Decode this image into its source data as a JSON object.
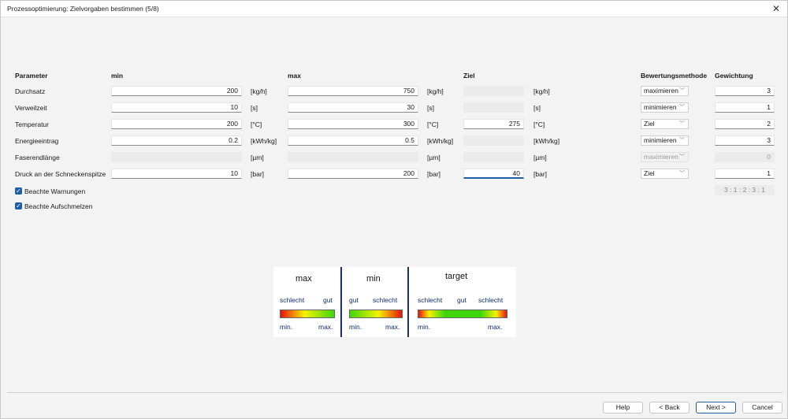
{
  "window": {
    "title": "Prozessoptimierung: Zielvorgaben bestimmen (5/8)",
    "close_glyph": "✕"
  },
  "headers": {
    "parameter": "Parameter",
    "min": "min",
    "max": "max",
    "ziel": "Ziel",
    "methode": "Bewertungsmethode",
    "gewichtung": "Gewichtung"
  },
  "rows": [
    {
      "label": "Durchsatz",
      "min": "200",
      "min_unit": "[kg/h]",
      "max": "750",
      "max_unit": "[kg/h]",
      "ziel": "",
      "ziel_unit": "[kg/h]",
      "methode": "maximieren",
      "gewichtung": "3"
    },
    {
      "label": "Verweilzeit",
      "min": "10",
      "min_unit": "[s]",
      "max": "30",
      "max_unit": "[s]",
      "ziel": "",
      "ziel_unit": "[s]",
      "methode": "minimieren",
      "gewichtung": "1"
    },
    {
      "label": "Temperatur",
      "min": "200",
      "min_unit": "[°C]",
      "max": "300",
      "max_unit": "[°C]",
      "ziel": "275",
      "ziel_unit": "[°C]",
      "methode": "Ziel",
      "gewichtung": "2"
    },
    {
      "label": "Energieeintrag",
      "min": "0.2",
      "min_unit": "[kWh/kg]",
      "max": "0.5",
      "max_unit": "[kWh/kg]",
      "ziel": "",
      "ziel_unit": "[kWh/kg]",
      "methode": "minimieren",
      "gewichtung": "3"
    },
    {
      "label": "Faserendlänge",
      "min": "",
      "min_unit": "[µm]",
      "max": "",
      "max_unit": "[µm]",
      "ziel": "",
      "ziel_unit": "[µm]",
      "methode": "maximieren",
      "gewichtung": "0"
    },
    {
      "label": "Druck an der Schneckenspitze",
      "min": "10",
      "min_unit": "[bar]",
      "max": "200",
      "max_unit": "[bar]",
      "ziel": "40",
      "ziel_unit": "[bar]",
      "methode": "Ziel",
      "gewichtung": "1"
    }
  ],
  "checkboxes": [
    {
      "label": "Beachte Warnungen",
      "checked": true
    },
    {
      "label": "Beachte Aufschmelzen",
      "checked": true
    }
  ],
  "ratio": "3 : 1 : 2 : 3 : 1",
  "legend": {
    "max": {
      "title": "max",
      "left": "schlecht",
      "right": "gut",
      "min_label": "min.",
      "max_label": "max."
    },
    "min": {
      "title": "min",
      "left": "gut",
      "right": "schlecht",
      "min_label": "min.",
      "max_label": "max."
    },
    "target": {
      "title": "target",
      "left": "schlecht",
      "middle": "gut",
      "right": "schlecht",
      "min_label": "min.",
      "max_label": "max."
    }
  },
  "buttons": {
    "help": "Help",
    "back": "< Back",
    "next": "Next >",
    "cancel": "Cancel"
  }
}
